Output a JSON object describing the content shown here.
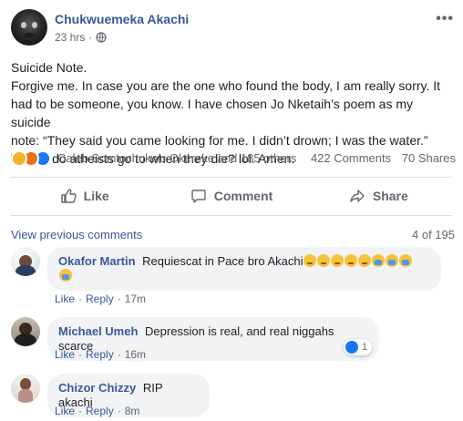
{
  "post": {
    "author": "Chukwuemeka Akachi",
    "time": "23 hrs",
    "visibility_icon": "globe-icon",
    "more_icon": "more-options-icon",
    "lines": [
      "Suicide Note.",
      "Forgive me. In case you are the one who found the body, I am really sorry. It",
      "had to be someone, you know. I have chosen Jo Nketaih’s poem as my suicide",
      "note: “They said you came looking for me. I didn’t drown; I was the water.”",
      "Where do atheists go to when they die? lol. Amen."
    ]
  },
  "reactions": {
    "icons": [
      "sad-reaction-icon",
      "angry-reaction-icon",
      "like-reaction-icon"
    ],
    "names": "Caleb Somtochukwu Okereke and 185 others",
    "comments": "422 Comments",
    "shares": "70 Shares"
  },
  "actions": {
    "like": "Like",
    "comment": "Comment",
    "share": "Share"
  },
  "comments_section": {
    "view_previous": "View previous comments",
    "count": "4 of 195",
    "items": [
      {
        "name": "Okafor Martin",
        "text": "Requiescat in Pace bro Akachi",
        "emojis": [
          "sad-face-emoji",
          "sad-face-emoji",
          "sad-face-emoji",
          "sad-face-emoji",
          "sad-face-emoji",
          "crying-face-emoji",
          "crying-face-emoji",
          "crying-face-emoji",
          "crying-face-emoji"
        ],
        "like": "Like",
        "reply": "Reply",
        "time": "17m"
      },
      {
        "name": "Michael Umeh",
        "text": "Depression is real, and real niggahs scarce",
        "like": "Like",
        "reply": "Reply",
        "time": "16m",
        "reaction_count": "1"
      },
      {
        "name": "Chizor Chizzy",
        "text": "RIP akachi",
        "like": "Like",
        "reply": "Reply",
        "time": "8m"
      }
    ]
  },
  "colors": {
    "link_blue": "#385898",
    "bubble_gray": "#f2f3f5",
    "text_secondary": "#616770",
    "like_blue": "#1877f2"
  }
}
